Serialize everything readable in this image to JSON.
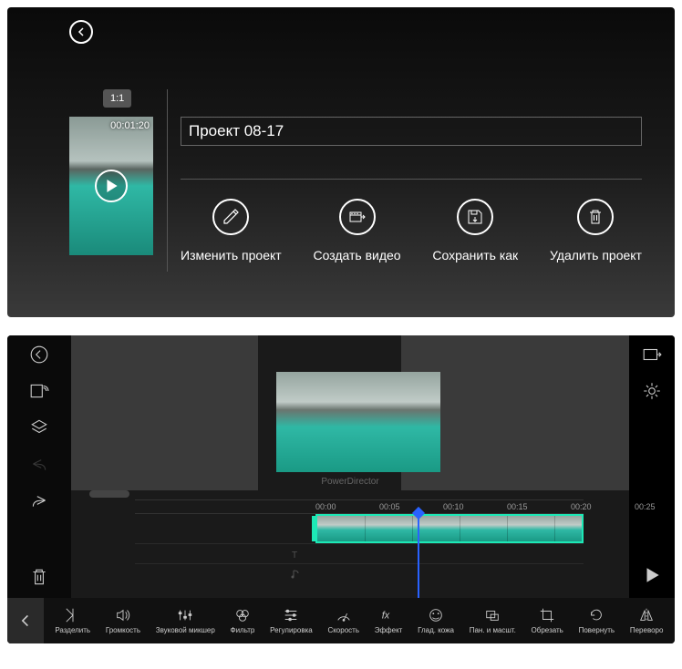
{
  "top": {
    "aspect": "1:1",
    "duration": "00:01:20",
    "project_name": "Проект 08-17",
    "actions": {
      "edit": "Изменить проект",
      "create": "Создать видео",
      "save_as": "Сохранить как",
      "delete": "Удалить проект"
    }
  },
  "editor": {
    "watermark": "PowerDirector",
    "ticks": [
      "00:00",
      "00:05",
      "00:10",
      "00:15",
      "00:20",
      "00:25"
    ]
  },
  "toolbar": {
    "split": "Разделить",
    "volume": "Громкость",
    "mixer": "Звуковой микшер",
    "filter": "Фильтр",
    "adjust": "Регулировка",
    "speed": "Скорость",
    "effect": "Эффект",
    "skin": "Глад. кожа",
    "pan": "Пан. и масшт.",
    "crop": "Обрезать",
    "rotate": "Повернуть",
    "flip": "Переворо"
  }
}
